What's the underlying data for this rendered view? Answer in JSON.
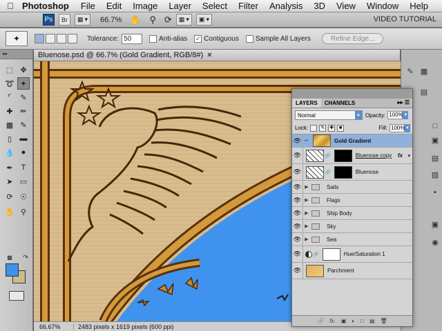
{
  "menubar": {
    "app_name": "Photoshop",
    "items": [
      "File",
      "Edit",
      "Image",
      "Layer",
      "Select",
      "Filter",
      "Analysis",
      "3D",
      "View",
      "Window",
      "Help"
    ],
    "apple_icon": "apple-icon"
  },
  "appbar": {
    "ps_label": "Ps",
    "br_label": "Br",
    "zoom": "66.7%",
    "workspace": "VIDEO TUTORIAL"
  },
  "options": {
    "tolerance_label": "Tolerance:",
    "tolerance_value": "50",
    "anti_alias_label": "Anti-alias",
    "anti_alias_checked": false,
    "contiguous_label": "Contiguous",
    "contiguous_checked": true,
    "sample_all_label": "Sample All Layers",
    "sample_all_checked": false,
    "refine_edge_label": "Refine Edge..."
  },
  "document": {
    "title": "Bluenose.psd @ 66.7% (Gold Gradient, RGB/8#)",
    "zoom": "66.67%",
    "info": "2483 pixels x 1619 pixels (600 ppi)"
  },
  "colors": {
    "foreground": "#3c92e6",
    "background": "#cdb98f",
    "sky": "#3f93ee",
    "parchment": "#d9bd8e"
  },
  "layers_panel": {
    "tabs": [
      "LAYERS",
      "CHANNELS"
    ],
    "active_tab": "LAYERS",
    "blend_mode": "Normal",
    "opacity_label": "Opacity:",
    "opacity": "100%",
    "lock_label": "Lock:",
    "fill_label": "Fill:",
    "fill": "100%",
    "layers": [
      {
        "name": "Gold Gradient",
        "type": "gradient",
        "selected": true
      },
      {
        "name": "Bluenose copy",
        "type": "masked",
        "fx": "fx"
      },
      {
        "name": "Bluenose",
        "type": "masked"
      },
      {
        "name": "Sails",
        "type": "group"
      },
      {
        "name": "Flags",
        "type": "group"
      },
      {
        "name": "Ship Body",
        "type": "group"
      },
      {
        "name": "Sky",
        "type": "group"
      },
      {
        "name": "Sea",
        "type": "group"
      },
      {
        "name": "Hue/Saturation 1",
        "type": "adjustment"
      },
      {
        "name": "Parchment",
        "type": "image"
      }
    ]
  }
}
